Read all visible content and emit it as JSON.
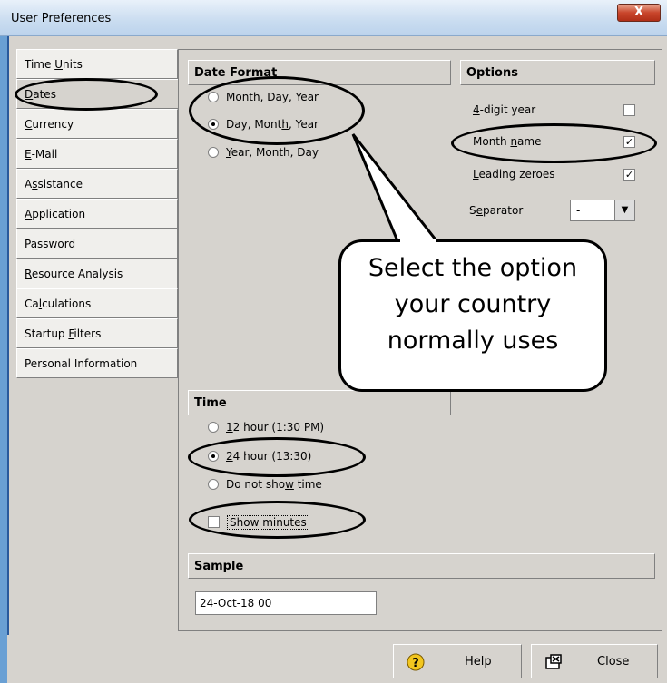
{
  "window": {
    "title": "User Preferences",
    "close_label": "X"
  },
  "tabs": [
    {
      "pre": "Time ",
      "u": "U",
      "post": "nits"
    },
    {
      "pre": "",
      "u": "D",
      "post": "ates"
    },
    {
      "pre": "",
      "u": "C",
      "post": "urrency"
    },
    {
      "pre": "",
      "u": "E",
      "post": "-Mail"
    },
    {
      "pre": "A",
      "u": "s",
      "post": "sistance"
    },
    {
      "pre": "",
      "u": "A",
      "post": "pplication"
    },
    {
      "pre": "",
      "u": "P",
      "post": "assword"
    },
    {
      "pre": "",
      "u": "R",
      "post": "esource Analysis"
    },
    {
      "pre": "Ca",
      "u": "l",
      "post": "culations"
    },
    {
      "pre": "Startup ",
      "u": "F",
      "post": "ilters"
    },
    {
      "pre": "Personal Information",
      "u": "",
      "post": ""
    }
  ],
  "date_format": {
    "heading": "Date Format",
    "options": [
      {
        "pre": "M",
        "u": "o",
        "post": "nth, Day, Year",
        "selected": false
      },
      {
        "pre": "Day, Mont",
        "u": "h",
        "post": ", Year",
        "selected": true
      },
      {
        "pre": "",
        "u": "Y",
        "post": "ear, Month, Day",
        "selected": false
      }
    ]
  },
  "options": {
    "heading": "Options",
    "items": [
      {
        "pre": "",
        "u": "4",
        "post": "-digit year",
        "checked": false
      },
      {
        "pre": "Month ",
        "u": "n",
        "post": "ame",
        "checked": true
      },
      {
        "pre": "",
        "u": "L",
        "post": "eading zeroes",
        "checked": true
      }
    ],
    "separator": {
      "pre": "S",
      "u": "e",
      "post": "parator",
      "value": "-"
    }
  },
  "time": {
    "heading": "Time",
    "options": [
      {
        "pre": "",
        "u": "1",
        "post": "2 hour (1:30 PM)",
        "selected": false
      },
      {
        "pre": "",
        "u": "2",
        "post": "4 hour (13:30)",
        "selected": true
      },
      {
        "pre": "Do not sho",
        "u": "w",
        "post": " time",
        "selected": false
      }
    ],
    "show_minutes": {
      "label": "Show minutes",
      "checked": false
    }
  },
  "sample": {
    "heading": "Sample",
    "value": "24-Oct-18 00"
  },
  "buttons": {
    "help": "Help",
    "close": "Close"
  },
  "callout": {
    "lines": [
      "Select the option",
      "your country",
      "normally uses"
    ]
  }
}
